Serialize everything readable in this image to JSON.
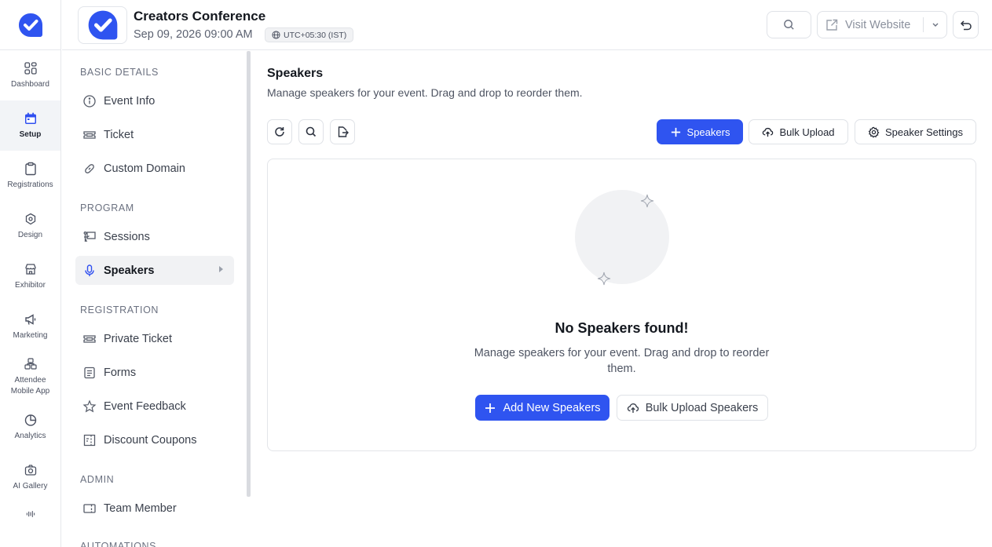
{
  "colors": {
    "accent": "#2f54f0",
    "active_bg": "#f1f2f4",
    "border": "#e3e5e9"
  },
  "rail": {
    "logo_icon": "brand-logo-icon",
    "items": [
      {
        "label": "Dashboard",
        "icon": "grid-icon"
      },
      {
        "label": "Setup",
        "icon": "calendar-icon",
        "active": true
      },
      {
        "label": "Registrations",
        "icon": "clipboard-icon"
      },
      {
        "label": "Design",
        "icon": "palette-icon"
      },
      {
        "label": "Exhibitor",
        "icon": "store-icon"
      },
      {
        "label": "Marketing",
        "icon": "megaphone-icon"
      },
      {
        "label_line1": "Attendee",
        "label_line2": "Mobile App",
        "icon": "boxes-icon"
      },
      {
        "label": "Analytics",
        "icon": "pie-chart-icon"
      },
      {
        "label": "AI Gallery",
        "icon": "camera-icon"
      }
    ]
  },
  "header": {
    "event_title": "Creators Conference",
    "event_date": "Sep 09, 2026 09:00 AM",
    "timezone": "UTC+05:30 (IST)",
    "visit_label": "Visit Website"
  },
  "settings_nav": {
    "sections": {
      "basic": "BASIC DETAILS",
      "program": "PROGRAM",
      "registration": "REGISTRATION",
      "admin": "ADMIN",
      "automations": "AUTOMATIONS"
    },
    "items": {
      "event_info": "Event Info",
      "ticket": "Ticket",
      "custom_domain": "Custom Domain",
      "sessions": "Sessions",
      "speakers": "Speakers",
      "private_ticket": "Private Ticket",
      "forms": "Forms",
      "event_feedback": "Event Feedback",
      "discount_coupons": "Discount Coupons",
      "team_member": "Team Member"
    }
  },
  "main": {
    "title": "Speakers",
    "subtitle": "Manage speakers for your event. Drag and drop to reorder them.",
    "add_speakers_label": "Speakers",
    "bulk_upload_label": "Bulk Upload",
    "speaker_settings_label": "Speaker Settings",
    "empty": {
      "title": "No Speakers found!",
      "subtitle": "Manage speakers for your event. Drag and drop to reorder them.",
      "add_label": "Add New Speakers",
      "bulk_label": "Bulk Upload Speakers"
    }
  }
}
